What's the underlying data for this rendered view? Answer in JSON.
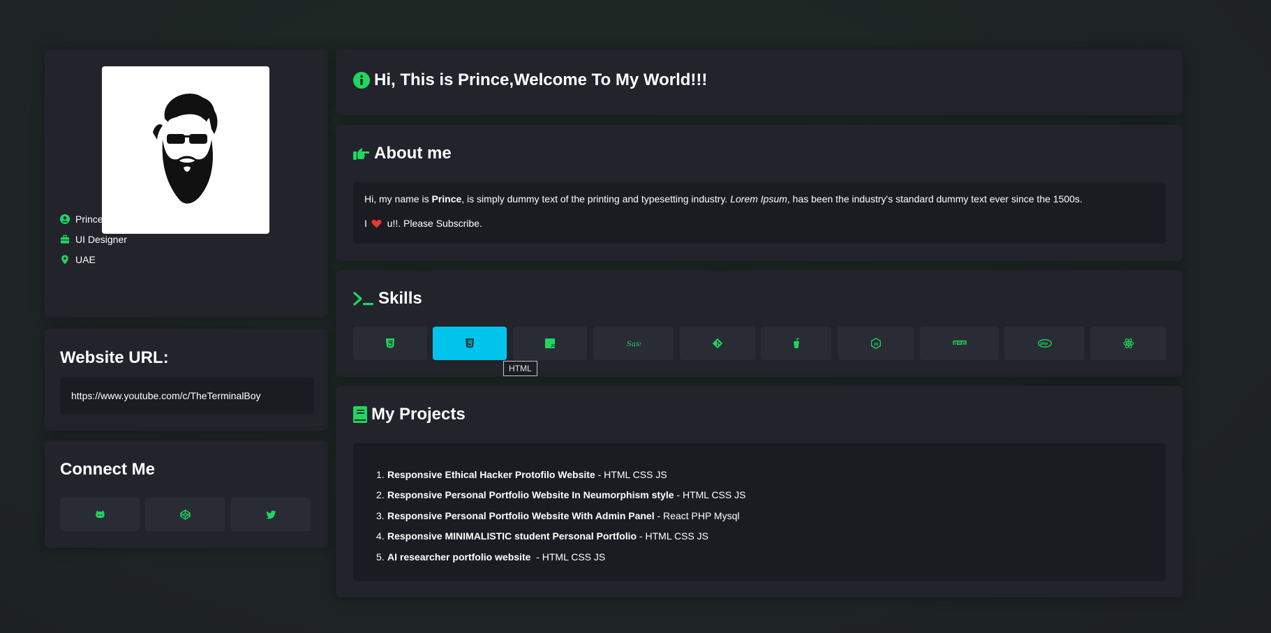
{
  "profile": {
    "name": "Prince",
    "role": "UI Designer",
    "location": "UAE",
    "icons": [
      "user-circle-icon",
      "briefcase-icon",
      "map-pin-icon"
    ]
  },
  "website": {
    "title": "Website URL:",
    "url": "https://www.youtube.com/c/TheTerminalBoy"
  },
  "connect": {
    "title": "Connect Me",
    "icons": [
      "github-icon",
      "codepen-icon",
      "twitter-icon"
    ]
  },
  "welcome": {
    "title": "Hi, This is Prince,Welcome To My World!!!",
    "icon": "info-circle-icon"
  },
  "about": {
    "title": "About me",
    "icon": "hand-point-right-icon",
    "line1_a": "Hi, my name is ",
    "line1_name": "Prince",
    "line1_b": ", is simply dummy text of the printing and typesetting industry. ",
    "line1_italic": "Lorem Ipsum",
    "line1_c": ", has been the industry's standard dummy text ever since the 1500s.",
    "line2_a": "I ",
    "line2_b": " u!!. Please Subscribe."
  },
  "skills": {
    "title": "Skills",
    "icon": "terminal-icon",
    "tooltip": "HTML",
    "items": [
      "html5-icon",
      "css3-icon",
      "js-icon",
      "sass-icon",
      "git-icon",
      "gulp-icon",
      "nodejs-icon",
      "npm-icon",
      "php-icon",
      "react-icon"
    ],
    "active_index": 1
  },
  "projects": {
    "title": "My Projects",
    "icon": "book-icon",
    "items": [
      {
        "num": "1.",
        "name": "Responsive Ethical Hacker Protofilo Website",
        "tech": " - HTML CSS JS"
      },
      {
        "num": "2.",
        "name": "Responsive Personal Portfolio Website In Neumorphism style",
        "tech": " - HTML CSS JS"
      },
      {
        "num": "3.",
        "name": "Responsive Personal Portfolio Website With Admin Panel",
        "tech": " - React PHP Mysql"
      },
      {
        "num": "4.",
        "name": "Responsive MINIMALISTIC student Personal Portfolio",
        "tech": " - HTML CSS JS"
      },
      {
        "num": "5.",
        "name": "AI researcher portfolio website ",
        "tech": " - HTML CSS JS"
      }
    ]
  },
  "colors": {
    "accent": "#1ed760",
    "active_skill": "#00c4ec",
    "card": "#22232b",
    "inner": "#1b1c22",
    "heart": "#e53935"
  }
}
